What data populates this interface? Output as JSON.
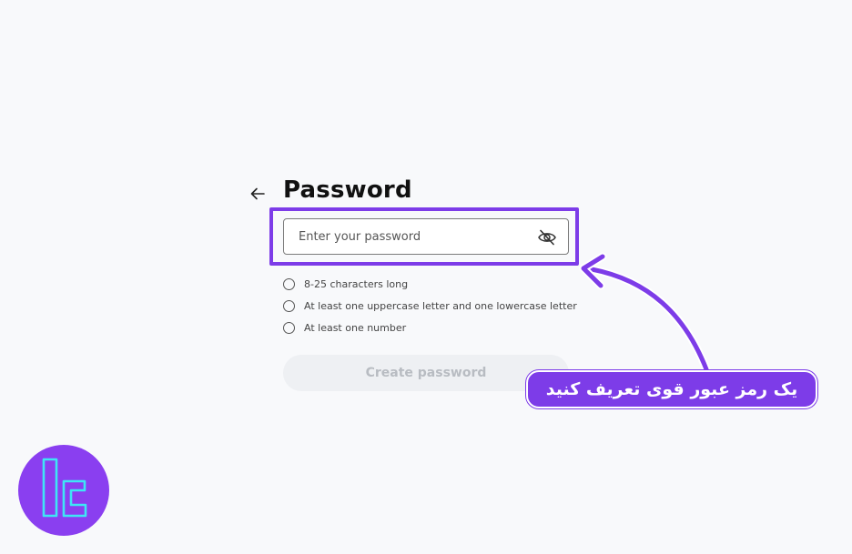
{
  "form": {
    "title": "Password",
    "password_placeholder": "Enter your password",
    "requirements": [
      "8-25 characters long",
      "At least one uppercase letter and one lowercase letter",
      "At least one number"
    ],
    "submit_label": "Create password"
  },
  "annotation": {
    "callout_text": "یک رمز عبور قوی تعریف کنید"
  },
  "icons": {
    "back": "arrow-left-icon",
    "visibility": "eye-slash-icon",
    "logo": "brand-logo-icon"
  },
  "colors": {
    "accent": "#7d3ce8",
    "logo_bg": "#8a3ff0",
    "logo_mark": "#3ee6f5",
    "background": "#f8f9fb",
    "button_disabled_bg": "#eef0f3",
    "button_disabled_text": "#b8bcc2"
  }
}
